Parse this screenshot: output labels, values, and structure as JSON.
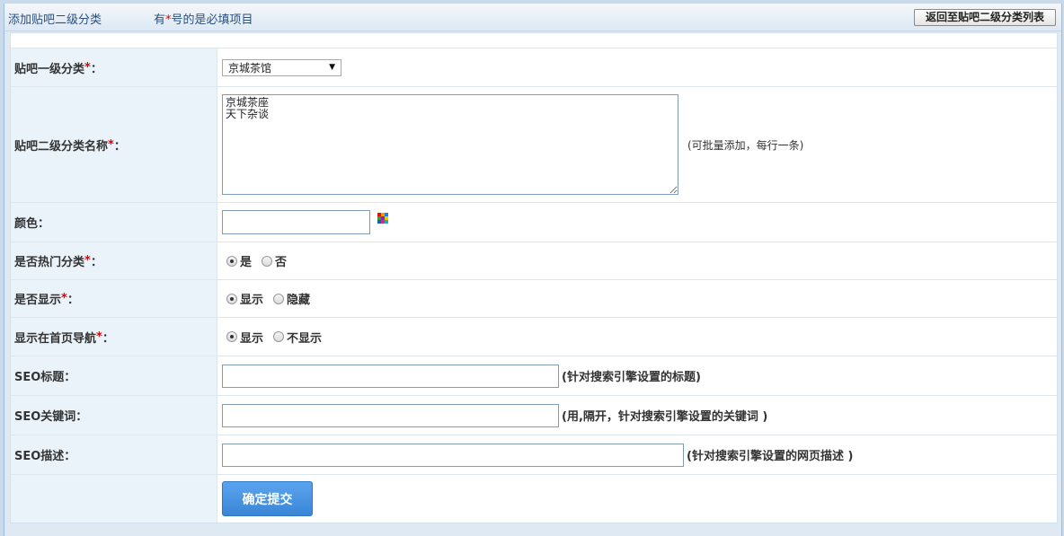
{
  "header": {
    "title": "添加贴吧二级分类",
    "required_prefix": "有",
    "required_star": "*",
    "required_suffix": "号的是必填项目",
    "back_button": "返回至贴吧二级分类列表"
  },
  "form": {
    "required_star": "*",
    "category1": {
      "label": "贴吧一级分类",
      "suffix": "：",
      "selected": "京城茶馆"
    },
    "category2": {
      "label": "贴吧二级分类名称",
      "suffix": "：",
      "value": "京城茶座\n天下杂谈",
      "hint": "(可批量添加，每行一条)"
    },
    "color": {
      "label": "颜色：",
      "value": ""
    },
    "hot": {
      "label": "是否热门分类",
      "suffix": "：",
      "options": [
        "是",
        "否"
      ],
      "selected": "是"
    },
    "display": {
      "label": "是否显示",
      "suffix": "：",
      "options": [
        "显示",
        "隐藏"
      ],
      "selected": "显示"
    },
    "home_nav": {
      "label": "显示在首页导航",
      "suffix": "：",
      "options": [
        "显示",
        "不显示"
      ],
      "selected": "显示"
    },
    "seo_title": {
      "label": "SEO标题：",
      "value": "",
      "hint": "(针对搜索引擎设置的标题)"
    },
    "seo_keywords": {
      "label": "SEO关键词：",
      "value": "",
      "hint": "(用,隔开，针对搜索引擎设置的关键词 )"
    },
    "seo_desc": {
      "label": "SEO描述：",
      "value": "",
      "hint": "(针对搜索引擎设置的网页描述 )"
    },
    "submit": "确定提交"
  },
  "colors": {
    "palette": [
      "#e01010",
      "#f0a000",
      "#2080e0",
      "#30a030",
      "#9020c0",
      "#e0d000",
      "#1060c0",
      "#d03080",
      "#20b0b0"
    ]
  }
}
